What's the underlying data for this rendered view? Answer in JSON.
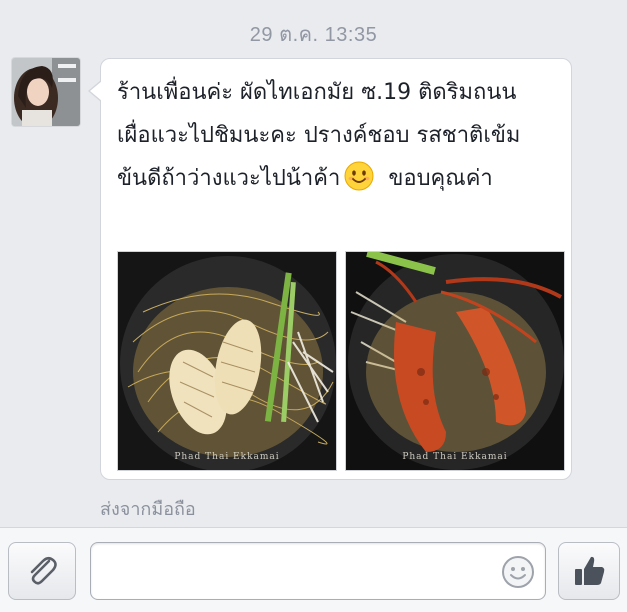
{
  "header": {
    "timestamp": "29 ต.ค. 13:35"
  },
  "message": {
    "lines": [
      "ร้านเพื่อนค่ะ ผัดไทเอกมัย ซ.19 ติดริมถนน",
      "เผื่อแวะไปชิมนะคะ ปรางค์ชอบ รสชาติเข้ม",
      "ข้นดีถ้าว่างแวะไปน้าค้า",
      "ขอบคุณค่า"
    ],
    "emoji": "smiling-face-icon",
    "photos": [
      {
        "caption": "Phad Thai Ekkamai",
        "subject": "grilled squid on crispy noodles"
      },
      {
        "caption": "Phad Thai Ekkamai",
        "subject": "grilled river prawns on noodles"
      }
    ],
    "sent_from": "ส่งจากมือถือ"
  },
  "composer": {
    "attach_icon": "paperclip-icon",
    "input_placeholder": "",
    "emoji_icon": "smiley-icon",
    "like_icon": "thumbs-up-icon"
  },
  "colors": {
    "background": "#e9ebef",
    "bubble": "#ffffff",
    "text": "#1d2129",
    "muted": "#8b919c"
  }
}
